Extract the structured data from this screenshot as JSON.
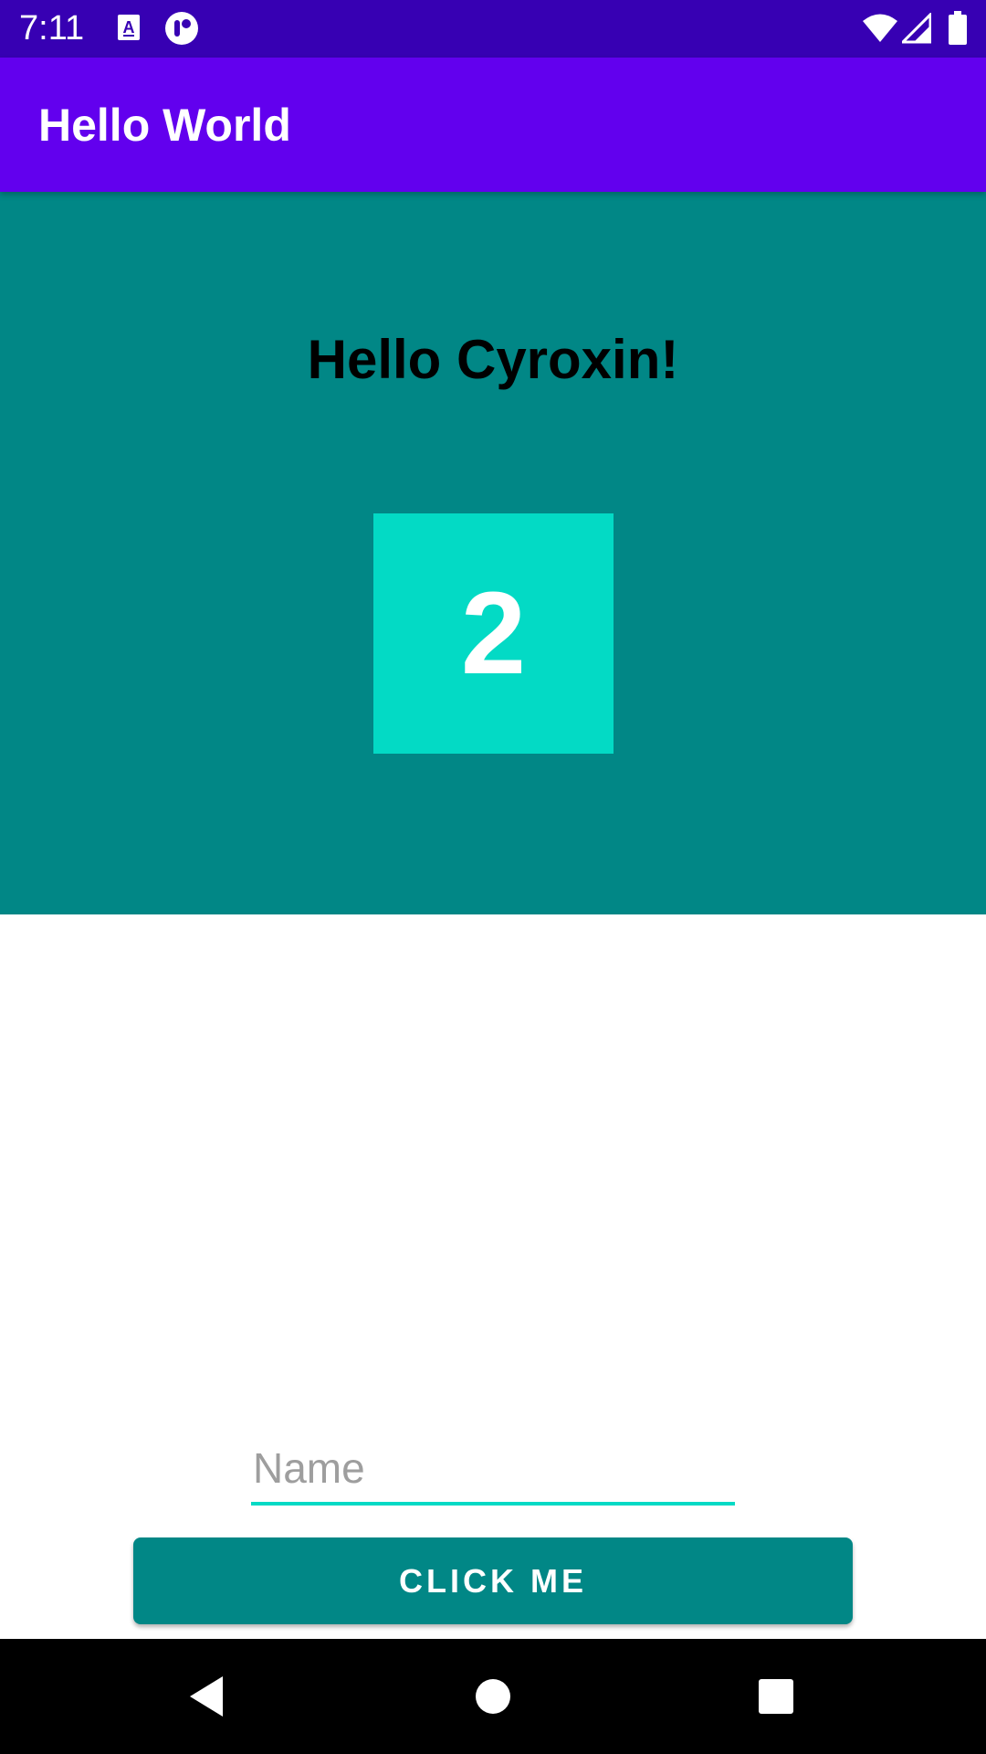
{
  "status_bar": {
    "time": "7:11",
    "notification_icons": [
      "text-a-icon",
      "record-icon"
    ],
    "system_icons": [
      "wifi-icon",
      "cell-signal-icon",
      "battery-icon"
    ]
  },
  "app_bar": {
    "title": "Hello World"
  },
  "hero": {
    "greeting": "Hello Cyroxin!",
    "counter": "2"
  },
  "form": {
    "name_placeholder": "Name",
    "name_value": "",
    "button_label": "CLICK ME"
  },
  "nav_bar": {
    "buttons": [
      "back-icon",
      "home-icon",
      "recents-icon"
    ]
  },
  "colors": {
    "status_bar": "#3700b3",
    "app_bar": "#6200ee",
    "hero_background": "#018786",
    "counter_background": "#03dac5",
    "button": "#018786",
    "input_underline": "#03dac5"
  }
}
